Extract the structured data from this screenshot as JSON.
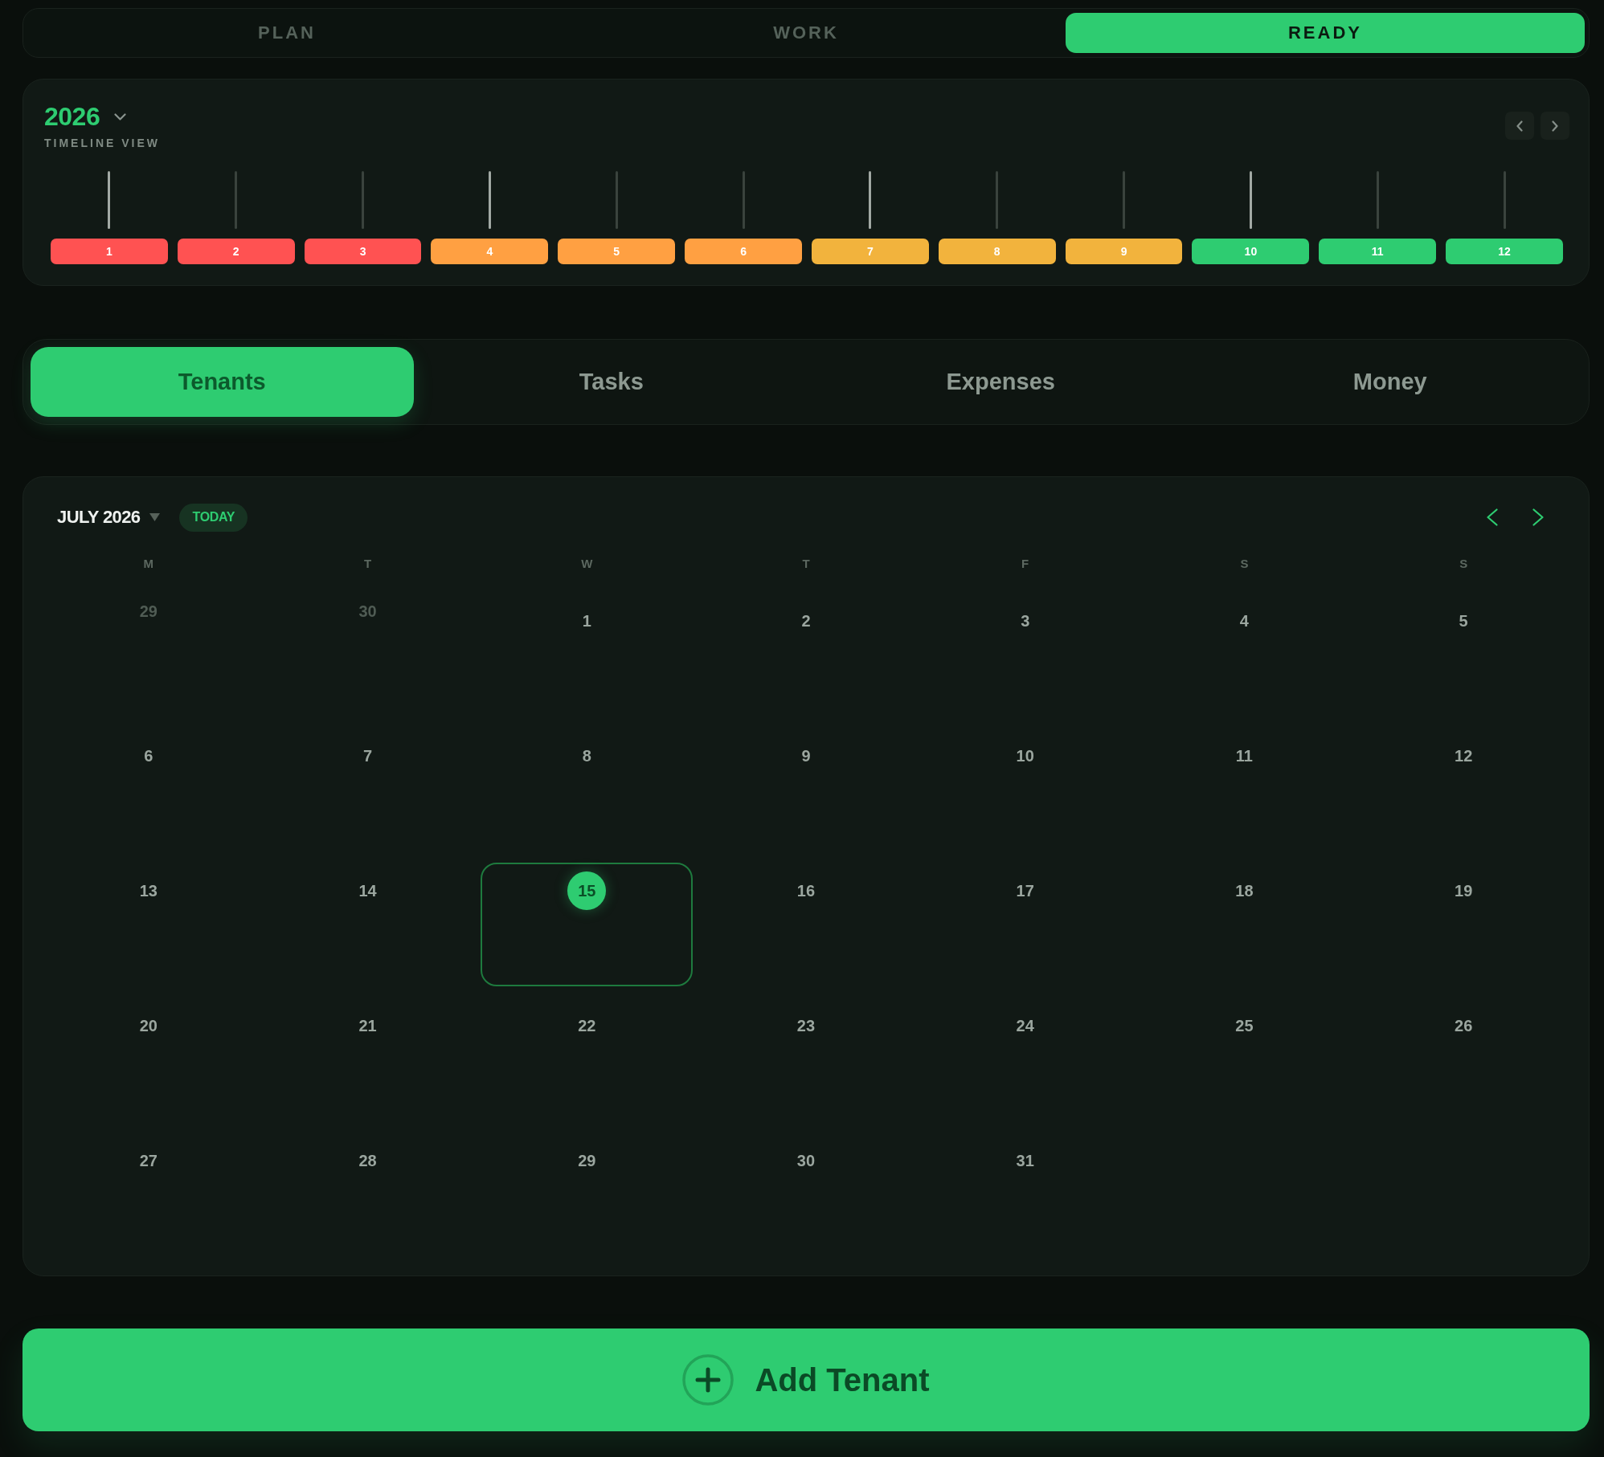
{
  "phase_tabs": [
    {
      "label": "PLAN",
      "selected": false
    },
    {
      "label": "WORK",
      "selected": false
    },
    {
      "label": "READY",
      "selected": true
    }
  ],
  "timeline": {
    "year": "2026",
    "subtitle": "TIMELINE VIEW",
    "months": [
      {
        "label": "1",
        "color": "#ff5252",
        "major": true
      },
      {
        "label": "2",
        "color": "#ff5252",
        "major": false
      },
      {
        "label": "3",
        "color": "#ff5252",
        "major": false
      },
      {
        "label": "4",
        "color": "#ffa042",
        "major": true
      },
      {
        "label": "5",
        "color": "#ffa042",
        "major": false
      },
      {
        "label": "6",
        "color": "#ffa042",
        "major": false
      },
      {
        "label": "7",
        "color": "#f2b33d",
        "major": true
      },
      {
        "label": "8",
        "color": "#f2b33d",
        "major": false
      },
      {
        "label": "9",
        "color": "#f2b33d",
        "major": false
      },
      {
        "label": "10",
        "color": "#2ecc71",
        "major": true
      },
      {
        "label": "11",
        "color": "#2ecc71",
        "major": false
      },
      {
        "label": "12",
        "color": "#2ecc71",
        "major": false
      }
    ]
  },
  "section_tabs": [
    {
      "label": "Tenants",
      "selected": true
    },
    {
      "label": "Tasks",
      "selected": false
    },
    {
      "label": "Expenses",
      "selected": false
    },
    {
      "label": "Money",
      "selected": false
    }
  ],
  "calendar": {
    "month_label": "JULY 2026",
    "today_button": "TODAY",
    "weekdays": [
      "M",
      "T",
      "W",
      "T",
      "F",
      "S",
      "S"
    ],
    "weeks": [
      [
        {
          "day": "29",
          "outside": true,
          "today": false
        },
        {
          "day": "30",
          "outside": true,
          "today": false
        },
        {
          "day": "1",
          "outside": false,
          "today": false
        },
        {
          "day": "2",
          "outside": false,
          "today": false
        },
        {
          "day": "3",
          "outside": false,
          "today": false
        },
        {
          "day": "4",
          "outside": false,
          "today": false
        },
        {
          "day": "5",
          "outside": false,
          "today": false
        }
      ],
      [
        {
          "day": "6",
          "outside": false,
          "today": false
        },
        {
          "day": "7",
          "outside": false,
          "today": false
        },
        {
          "day": "8",
          "outside": false,
          "today": false
        },
        {
          "day": "9",
          "outside": false,
          "today": false
        },
        {
          "day": "10",
          "outside": false,
          "today": false
        },
        {
          "day": "11",
          "outside": false,
          "today": false
        },
        {
          "day": "12",
          "outside": false,
          "today": false
        }
      ],
      [
        {
          "day": "13",
          "outside": false,
          "today": false
        },
        {
          "day": "14",
          "outside": false,
          "today": false
        },
        {
          "day": "15",
          "outside": false,
          "today": true
        },
        {
          "day": "16",
          "outside": false,
          "today": false
        },
        {
          "day": "17",
          "outside": false,
          "today": false
        },
        {
          "day": "18",
          "outside": false,
          "today": false
        },
        {
          "day": "19",
          "outside": false,
          "today": false
        }
      ],
      [
        {
          "day": "20",
          "outside": false,
          "today": false
        },
        {
          "day": "21",
          "outside": false,
          "today": false
        },
        {
          "day": "22",
          "outside": false,
          "today": false
        },
        {
          "day": "23",
          "outside": false,
          "today": false
        },
        {
          "day": "24",
          "outside": false,
          "today": false
        },
        {
          "day": "25",
          "outside": false,
          "today": false
        },
        {
          "day": "26",
          "outside": false,
          "today": false
        }
      ],
      [
        {
          "day": "27",
          "outside": false,
          "today": false
        },
        {
          "day": "28",
          "outside": false,
          "today": false
        },
        {
          "day": "29",
          "outside": false,
          "today": false
        },
        {
          "day": "30",
          "outside": false,
          "today": false
        },
        {
          "day": "31",
          "outside": false,
          "today": false
        }
      ]
    ]
  },
  "add_button": {
    "label": "Add Tenant"
  }
}
